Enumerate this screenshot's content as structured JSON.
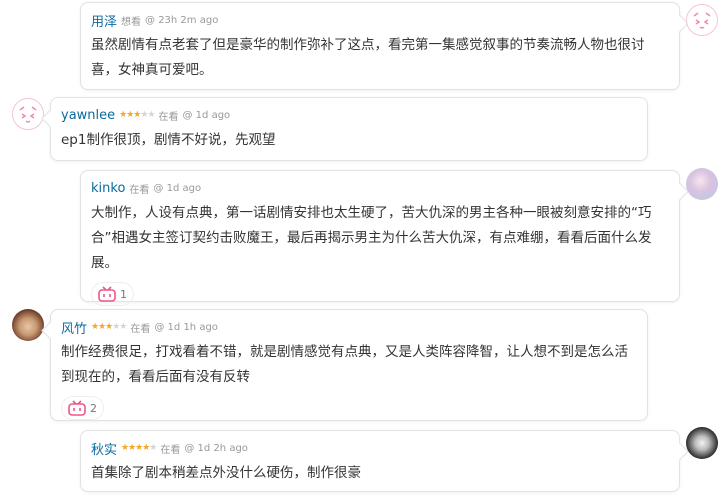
{
  "comments": [
    {
      "name": "用泽",
      "status": "想看",
      "time": "@ 23h 2m ago",
      "text": "虽然剧情有点老套了但是豪华的制作弥补了这点，看完第一集感觉叙事的节奏流畅人物也很讨喜，女神真可爱吧。",
      "avatar": "bilibili-tv-avatar",
      "rating": 0
    },
    {
      "name": "yawnlee",
      "status": "在看",
      "time": "@ 1d ago",
      "text": "ep1制作很顶，剧情不好说，先观望",
      "avatar": "bilibili-tv-avatar",
      "rating": 3
    },
    {
      "name": "kinko",
      "status": "在看",
      "time": "@ 1d ago",
      "text": "大制作，人设有点典，第一话剧情安排也太生硬了，苦大仇深的男主各种一眼被刻意安排的“巧合”相遇女主签订契约击败魔王，最后再揭示男主为什么苦大仇深，有点难绷，看看后面什么发展。",
      "avatar": "photo-avatar",
      "rating": 0,
      "likes": "1"
    },
    {
      "name": "风竹",
      "status": "在看",
      "time": "@ 1d 1h ago",
      "text": "制作经费很足，打戏看着不错，就是剧情感觉有点典，又是人类阵容降智，让人想不到是怎么活到现在的，看看后面有没有反转",
      "avatar": "photo-avatar",
      "rating": 3,
      "likes": "2"
    },
    {
      "name": "秋实",
      "status": "在看",
      "time": "@ 1d 2h ago",
      "text": "首集除了剧本稍差点外没什么硬伤，制作很豪",
      "avatar": "photo-avatar",
      "rating": 4
    }
  ],
  "colors": {
    "username": "#0a6a9e",
    "star": "#f5a623",
    "like_icon": "#e8588c"
  }
}
